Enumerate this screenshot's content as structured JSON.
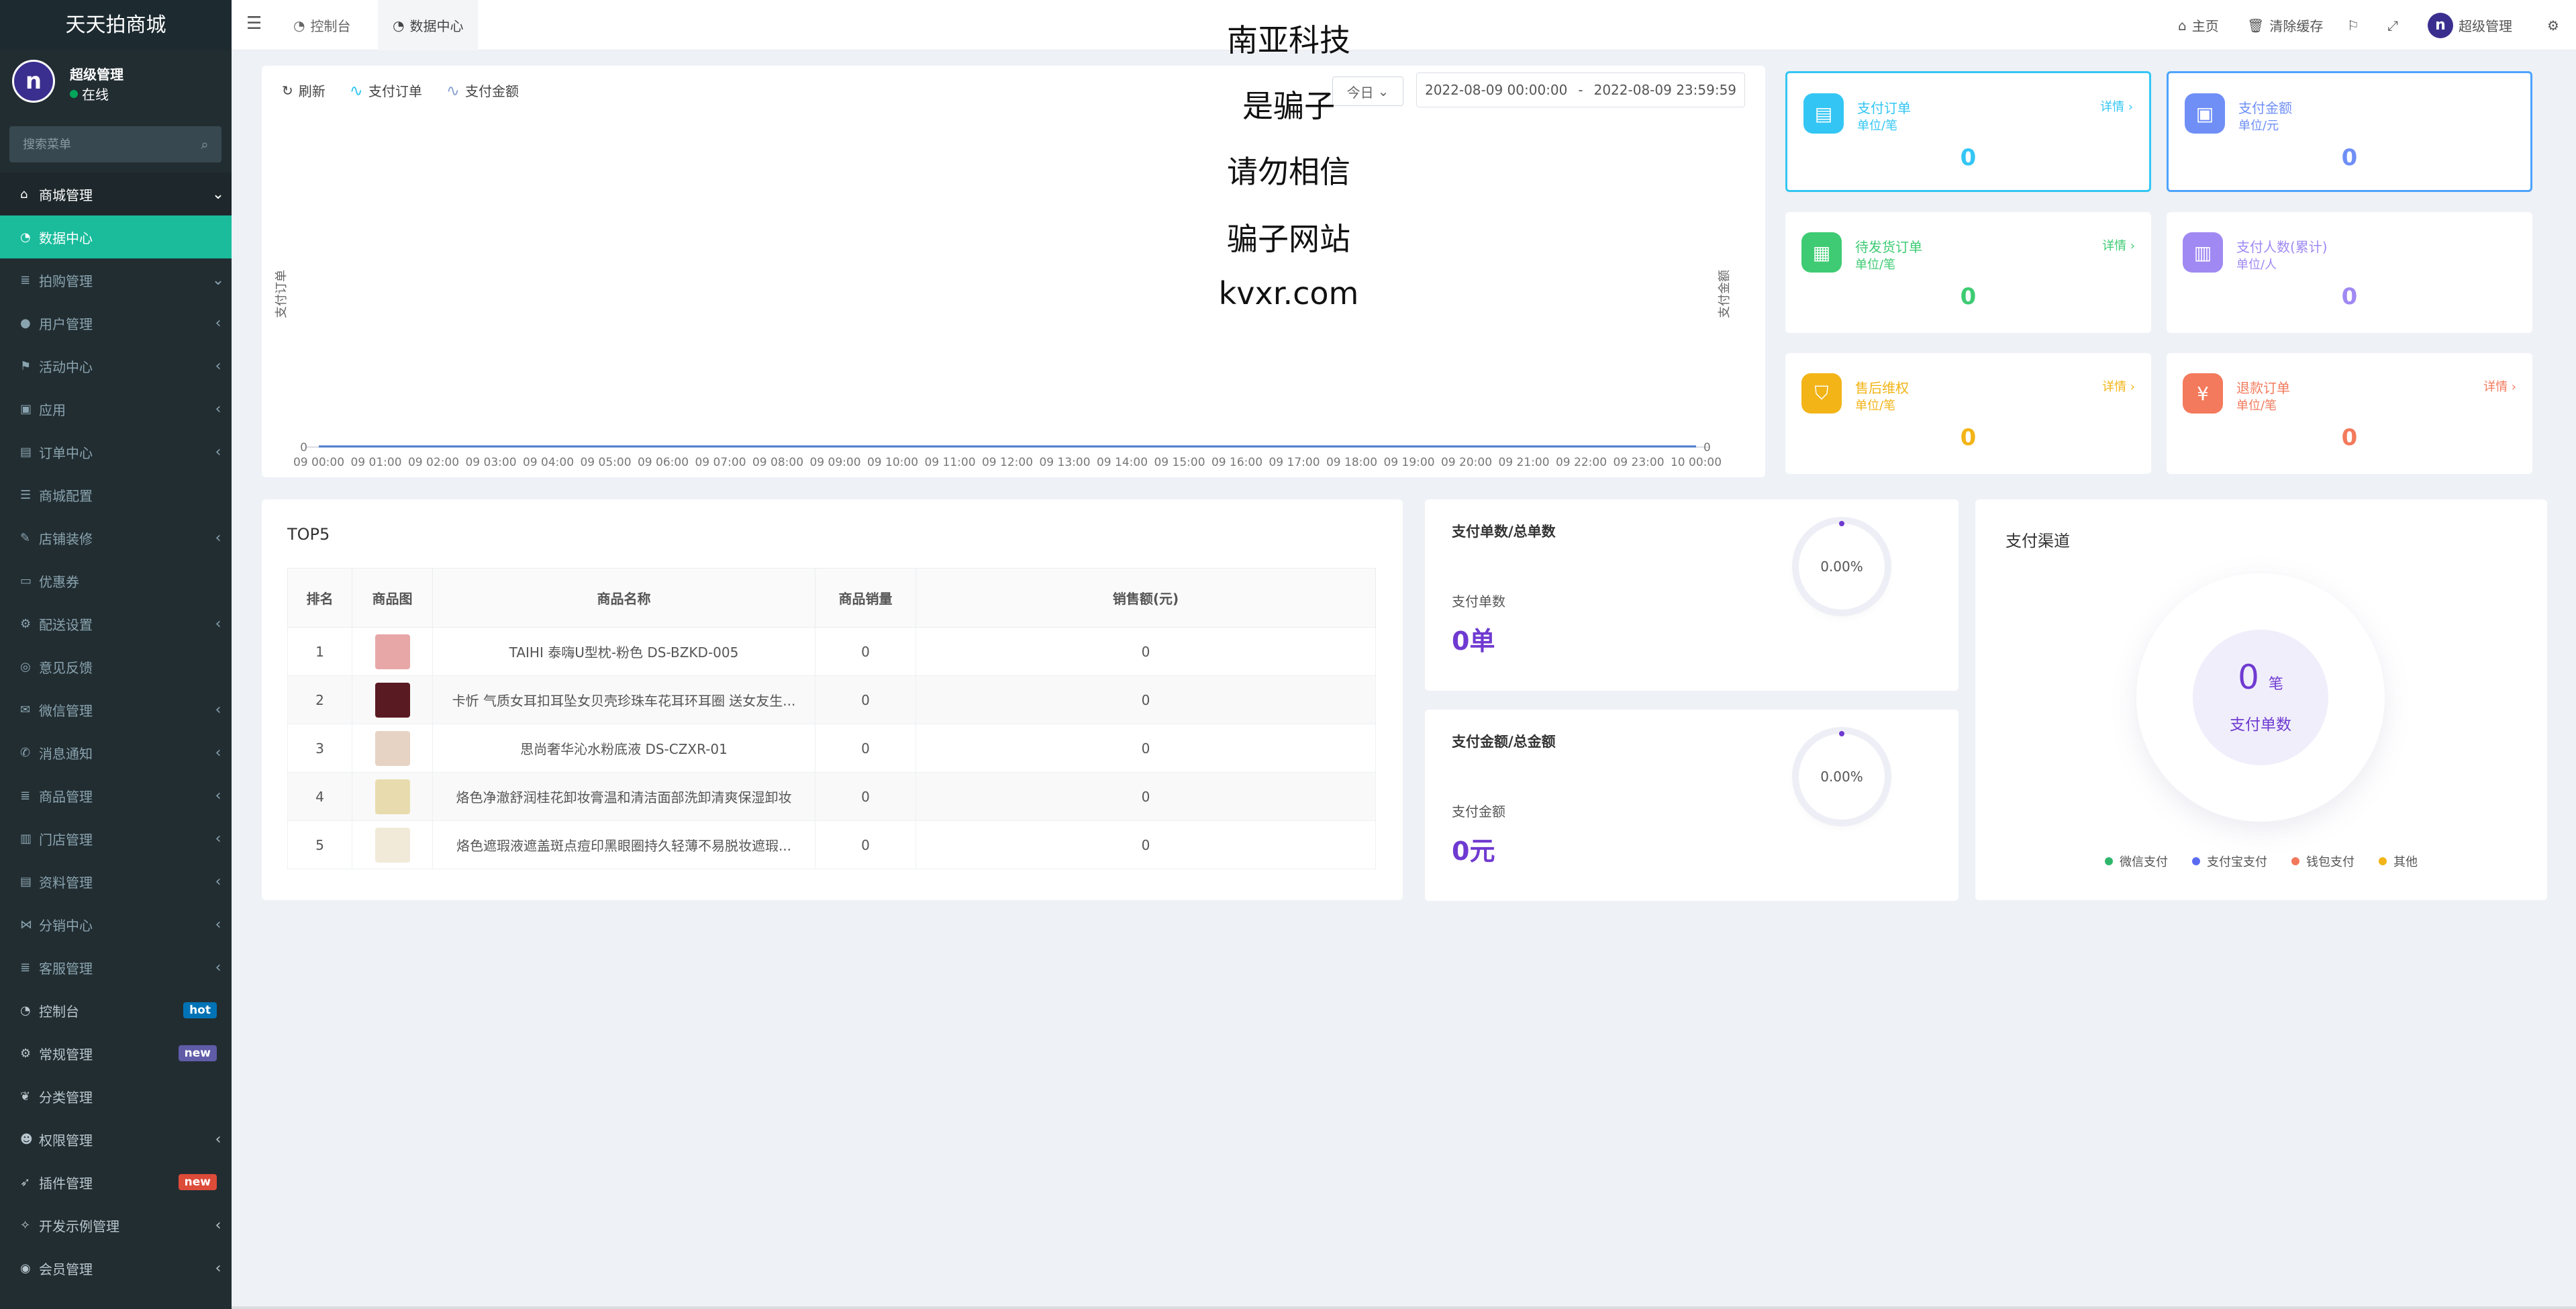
{
  "brand": {
    "title": "天天拍商城"
  },
  "user": {
    "avatar_letter": "n",
    "name": "超级管理",
    "status": "在线"
  },
  "search": {
    "placeholder": "搜索菜单"
  },
  "menu": [
    {
      "label": "商城管理",
      "icon": "home-icon",
      "type": "parent",
      "caret": "⌄"
    },
    {
      "label": "数据中心",
      "icon": "dashboard-icon",
      "type": "active"
    },
    {
      "label": "拍购管理",
      "icon": "list-icon",
      "caret": "⌄"
    },
    {
      "label": "用户管理",
      "icon": "user-icon",
      "caret": "‹"
    },
    {
      "label": "活动中心",
      "icon": "flag-icon",
      "caret": "‹"
    },
    {
      "label": "应用",
      "icon": "briefcase-icon",
      "caret": "‹"
    },
    {
      "label": "订单中心",
      "icon": "file-icon",
      "caret": "‹"
    },
    {
      "label": "商城配置",
      "icon": "sliders-icon"
    },
    {
      "label": "店铺装修",
      "icon": "brush-icon",
      "caret": "‹"
    },
    {
      "label": "优惠券",
      "icon": "coupon-icon"
    },
    {
      "label": "配送设置",
      "icon": "cogs-icon",
      "caret": "‹"
    },
    {
      "label": "意见反馈",
      "icon": "compass-icon"
    },
    {
      "label": "微信管理",
      "icon": "wechat-icon",
      "caret": "‹"
    },
    {
      "label": "消息通知",
      "icon": "bullhorn-icon",
      "caret": "‹"
    },
    {
      "label": "商品管理",
      "icon": "list-icon",
      "caret": "‹"
    },
    {
      "label": "门店管理",
      "icon": "bank-icon",
      "caret": "‹"
    },
    {
      "label": "资料管理",
      "icon": "file-icon",
      "caret": "‹"
    },
    {
      "label": "分销中心",
      "icon": "share-icon",
      "caret": "‹"
    },
    {
      "label": "客服管理",
      "icon": "list-icon",
      "caret": "‹"
    },
    {
      "label": "控制台",
      "icon": "dashboard-icon",
      "type": "top",
      "badge": "hot",
      "badge_color": "#0073b7"
    },
    {
      "label": "常规管理",
      "icon": "cogs-icon",
      "type": "top",
      "badge": "new",
      "badge_color": "#605ca8"
    },
    {
      "label": "分类管理",
      "icon": "leaf-icon",
      "type": "top"
    },
    {
      "label": "权限管理",
      "icon": "group-icon",
      "type": "top",
      "caret": "‹"
    },
    {
      "label": "插件管理",
      "icon": "rocket-icon",
      "type": "top",
      "badge": "new",
      "badge_color": "#dd4b39"
    },
    {
      "label": "开发示例管理",
      "icon": "magic-icon",
      "type": "top",
      "caret": "‹"
    },
    {
      "label": "会员管理",
      "icon": "user-circle-icon",
      "type": "top",
      "caret": "‹"
    }
  ],
  "header": {
    "tabs": [
      {
        "label": "控制台",
        "icon": "dashboard-icon"
      },
      {
        "label": "数据中心",
        "icon": "dashboard-icon"
      }
    ],
    "home": "主页",
    "clear_cache": "清除缓存",
    "admin": "超级管理"
  },
  "overlay": {
    "line1": "南亚科技",
    "line2": "是骗子",
    "line3": "请勿相信",
    "line4": "骗子网站",
    "line5": "kvxr.com"
  },
  "chart_controls": {
    "refresh": "刷新",
    "legend_orders": "支付订单",
    "legend_amount": "支付金额",
    "range": "今日",
    "date_start": "2022-08-09 00:00:00",
    "date_sep": "-",
    "date_end": "2022-08-09 23:59:59"
  },
  "chart_data": {
    "type": "line",
    "ylabel_left": "支付订单",
    "ylabel_right": "支付金额",
    "y_tick_left": "0",
    "y_tick_right": "0",
    "x": [
      "09 00:00",
      "09 01:00",
      "09 02:00",
      "09 03:00",
      "09 04:00",
      "09 05:00",
      "09 06:00",
      "09 07:00",
      "09 08:00",
      "09 09:00",
      "09 10:00",
      "09 11:00",
      "09 12:00",
      "09 13:00",
      "09 14:00",
      "09 15:00",
      "09 16:00",
      "09 17:00",
      "09 18:00",
      "09 19:00",
      "09 20:00",
      "09 21:00",
      "09 22:00",
      "09 23:00",
      "10 00:00"
    ],
    "series": [
      {
        "name": "支付订单",
        "color": "#33c6f4",
        "values": [
          0,
          0,
          0,
          0,
          0,
          0,
          0,
          0,
          0,
          0,
          0,
          0,
          0,
          0,
          0,
          0,
          0,
          0,
          0,
          0,
          0,
          0,
          0,
          0,
          0
        ]
      },
      {
        "name": "支付金额",
        "color": "#4f7fd0",
        "values": [
          0,
          0,
          0,
          0,
          0,
          0,
          0,
          0,
          0,
          0,
          0,
          0,
          0,
          0,
          0,
          0,
          0,
          0,
          0,
          0,
          0,
          0,
          0,
          0,
          0
        ]
      }
    ],
    "ylim": [
      0,
      0
    ]
  },
  "stats": [
    {
      "title": "支付订单",
      "unit": "单位/笔",
      "value": "0",
      "detail": "详情 ›",
      "color": "#33c6f4",
      "icon": "file-icon"
    },
    {
      "title": "支付金额",
      "unit": "单位/元",
      "value": "0",
      "detail": "",
      "color": "#6f8ff6",
      "icon": "wallet-icon"
    },
    {
      "title": "待发货订单",
      "unit": "单位/笔",
      "value": "0",
      "detail": "详情 ›",
      "color": "#3ecb73",
      "icon": "calendar-icon"
    },
    {
      "title": "支付人数(累计)",
      "unit": "单位/人",
      "value": "0",
      "detail": "",
      "color": "#a089f3",
      "icon": "chart-icon"
    },
    {
      "title": "售后维权",
      "unit": "单位/笔",
      "value": "0",
      "detail": "详情 ›",
      "color": "#f2b417",
      "icon": "shield-icon"
    },
    {
      "title": "退款订单",
      "unit": "单位/笔",
      "value": "0",
      "detail": "详情 ›",
      "color": "#f37a5c",
      "icon": "yen-icon"
    }
  ],
  "top5": {
    "title": "TOP5",
    "columns": [
      "排名",
      "商品图",
      "商品名称",
      "商品销量",
      "销售额(元)"
    ],
    "rows": [
      {
        "rank": "1",
        "name": "TAIHI 泰嗨U型枕-粉色 DS-BZKD-005",
        "sales": "0",
        "amount": "0",
        "thumb": "#e8a7a7"
      },
      {
        "rank": "2",
        "name": "卡忻 气质女耳扣耳坠女贝壳珍珠车花耳环耳圈 送女友生...",
        "sales": "0",
        "amount": "0",
        "thumb": "#5a1a22"
      },
      {
        "rank": "3",
        "name": "思尚奢华沁水粉底液 DS-CZXR-01",
        "sales": "0",
        "amount": "0",
        "thumb": "#e6d3c4"
      },
      {
        "rank": "4",
        "name": "烙色净澈舒润桂花卸妆膏温和清洁面部洗卸清爽保湿卸妆",
        "sales": "0",
        "amount": "0",
        "thumb": "#e8dcae"
      },
      {
        "rank": "5",
        "name": "烙色遮瑕液遮盖斑点痘印黑眼圈持久轻薄不易脱妆遮瑕...",
        "sales": "0",
        "amount": "0",
        "thumb": "#f2ead8"
      }
    ]
  },
  "ratio_cards": [
    {
      "title": "支付单数/总单数",
      "percent": "0.00%",
      "label": "支付单数",
      "value": "0单"
    },
    {
      "title": "支付金额/总金额",
      "percent": "0.00%",
      "label": "支付金额",
      "value": "0元"
    }
  ],
  "channel": {
    "title": "支付渠道",
    "value": "0",
    "unit": "笔",
    "label": "支付单数",
    "legend": [
      {
        "name": "微信支付",
        "color": "#2fb66b"
      },
      {
        "name": "支付宝支付",
        "color": "#5b6bf0"
      },
      {
        "name": "钱包支付",
        "color": "#f2785c"
      },
      {
        "name": "其他",
        "color": "#f2b417"
      }
    ]
  }
}
